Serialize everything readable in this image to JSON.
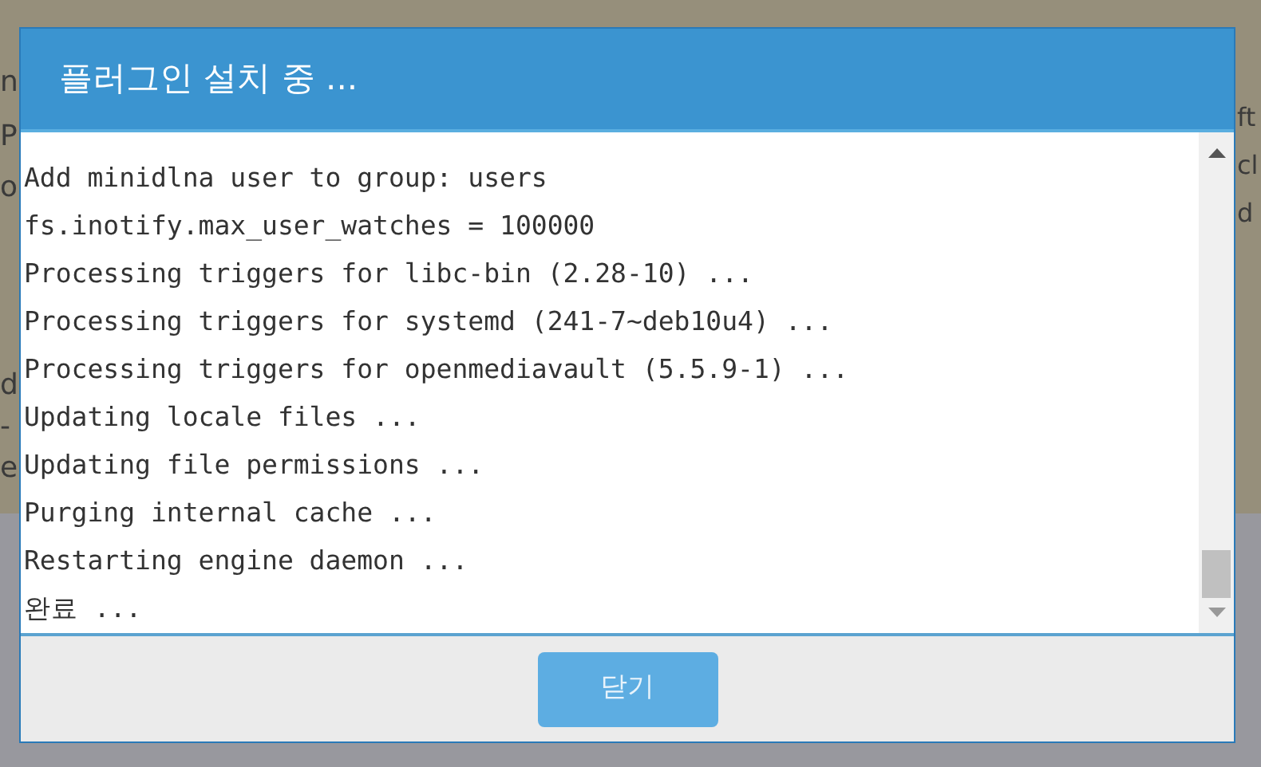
{
  "background": {
    "left_fragments": [
      "n",
      "P",
      "o",
      "d",
      "-",
      "e"
    ],
    "right_fragments": [
      "ft",
      "cl",
      "d"
    ]
  },
  "dialog": {
    "title": "플러그인 설치 중 ...",
    "log_lines": [
      "Add minidlna user to group: users",
      "fs.inotify.max_user_watches = 100000",
      "Processing triggers for libc-bin (2.28-10) ...",
      "Processing triggers for systemd (241-7~deb10u4) ...",
      "Processing triggers for openmediavault (5.5.9-1) ...",
      "Updating locale files ...",
      "Updating file permissions ...",
      "Purging internal cache ...",
      "Restarting engine daemon ...",
      "완료 ..."
    ],
    "buttons": [
      {
        "label": "닫기",
        "disabled": true
      }
    ]
  }
}
